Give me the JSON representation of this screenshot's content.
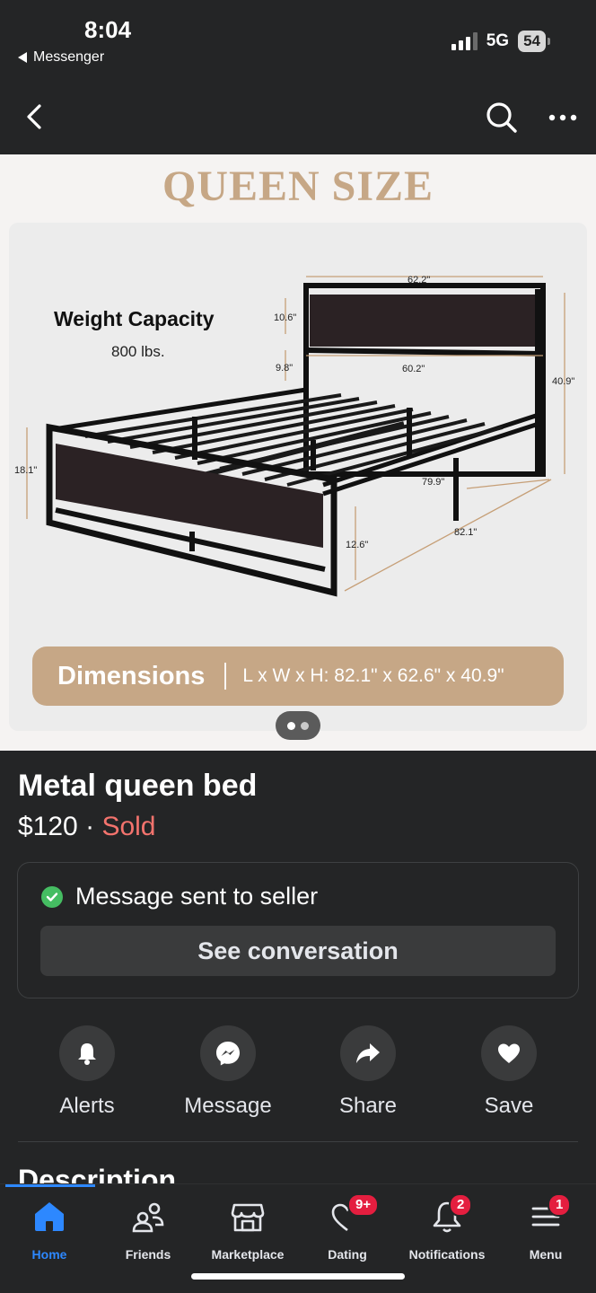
{
  "status_bar": {
    "time": "8:04",
    "back_app": "Messenger",
    "network": "5G",
    "battery": "54"
  },
  "image": {
    "heading": "QUEEN SIZE",
    "weight_title": "Weight Capacity",
    "weight_value": "800 lbs.",
    "dimensions_label": "Dimensions",
    "dimensions_value": "L x W x H:  82.1\" x 62.6\" x 40.9\"",
    "measurements": {
      "top_width": "62.2\"",
      "headboard_height": "10.6\"",
      "gap_height": "9.8\"",
      "inner_width": "60.2\"",
      "total_height": "40.9\"",
      "foot_height": "18.1\"",
      "inner_length": "79.9\"",
      "clearance": "12.6\"",
      "length": "82.1\""
    }
  },
  "listing": {
    "title": "Metal queen bed",
    "price": "$120",
    "separator": "·",
    "status": "Sold"
  },
  "message_card": {
    "text": "Message sent to seller",
    "button": "See conversation"
  },
  "actions": [
    {
      "label": "Alerts",
      "icon": "bell-icon"
    },
    {
      "label": "Message",
      "icon": "messenger-icon"
    },
    {
      "label": "Share",
      "icon": "share-arrow-icon"
    },
    {
      "label": "Save",
      "icon": "heart-icon"
    }
  ],
  "description_heading": "Description",
  "tabbar": {
    "tabs": [
      {
        "label": "Home",
        "icon": "home-icon",
        "active": true
      },
      {
        "label": "Friends",
        "icon": "friends-icon"
      },
      {
        "label": "Marketplace",
        "icon": "marketplace-icon"
      },
      {
        "label": "Dating",
        "icon": "dating-icon",
        "badge": "9+"
      },
      {
        "label": "Notifications",
        "icon": "bell-icon",
        "badge": "2"
      },
      {
        "label": "Menu",
        "icon": "menu-icon",
        "badge": "1"
      }
    ]
  },
  "colors": {
    "background": "#242526",
    "accent": "#2d88ff",
    "sold": "#f3736d",
    "gold": "#c6a786",
    "success": "#45bd62",
    "badge": "#e41e3f"
  }
}
